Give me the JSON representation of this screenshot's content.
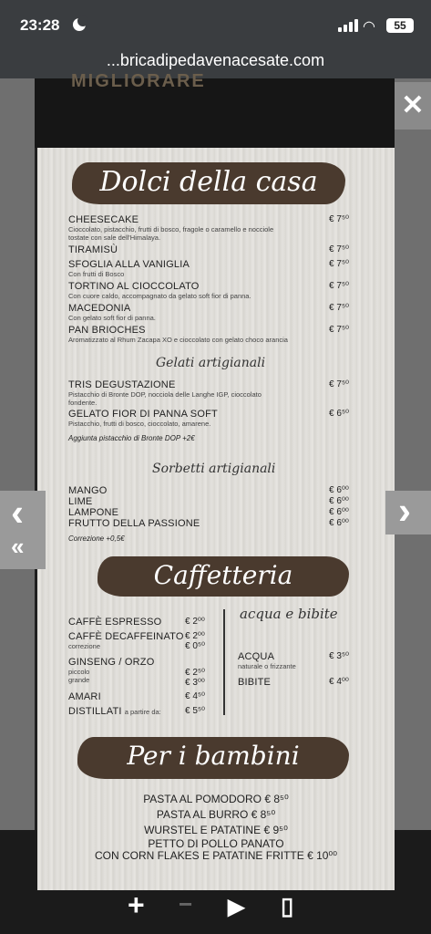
{
  "status": {
    "time": "23:28",
    "battery": "55"
  },
  "browser": {
    "url": "...bricadipedavenacesate.com"
  },
  "poster_header_text": "MIGLIORARE",
  "controls": {
    "close": "✕",
    "prev": "‹",
    "next": "›",
    "first": "«"
  },
  "dolci": {
    "title": "Dolci della casa",
    "items": [
      {
        "name": "CHEESECAKE",
        "desc": "Cioccolato, pistacchio, frutti di bosco, fragole o caramello e nocciole tostate con sale dell'Himalaya.",
        "price": "€ 7⁵⁰"
      },
      {
        "name": "TIRAMISÙ",
        "desc": "",
        "price": "€ 7⁵⁰"
      },
      {
        "name": "SFOGLIA ALLA VANIGLIA",
        "desc": "Con frutti di Bosco",
        "price": "€ 7⁵⁰"
      },
      {
        "name": "TORTINO AL CIOCCOLATO",
        "desc": "Con cuore caldo, accompagnato da gelato soft fior di panna.",
        "price": "€ 7⁵⁰"
      },
      {
        "name": "MACEDONIA",
        "desc": "Con gelato soft fior di panna.",
        "price": "€ 7⁵⁰"
      },
      {
        "name": "PAN BRIOCHES",
        "desc": "Aromatizzato al Rhum Zacapa XO e cioccolato con gelato choco arancia",
        "price": "€ 7⁵⁰"
      }
    ]
  },
  "gelati": {
    "title": "Gelati artigianali",
    "items": [
      {
        "name": "TRIS DEGUSTAZIONE",
        "desc": "Pistacchio di Bronte DOP, nocciola delle Langhe IGP, cioccolato fondente.",
        "price": "€ 7⁵⁰"
      },
      {
        "name": "GELATO FIOR DI PANNA SOFT",
        "desc": "Pistacchio, frutti di bosco, cioccolato, amarene.",
        "price": "€ 6⁵⁰"
      }
    ],
    "note": "Aggiunta pistacchio di Bronte DOP +2€"
  },
  "sorbetti": {
    "title": "Sorbetti artigianali",
    "items": [
      {
        "name": "MANGO",
        "price": "€ 6⁰⁰"
      },
      {
        "name": "LIME",
        "price": "€ 6⁰⁰"
      },
      {
        "name": "LAMPONE",
        "price": "€ 6⁰⁰"
      },
      {
        "name": "FRUTTO DELLA PASSIONE",
        "price": "€ 6⁰⁰"
      }
    ],
    "note": "Correzione +0,5€"
  },
  "caffetteria": {
    "title": "Caffetteria",
    "left": [
      {
        "name": "CAFFÈ ESPRESSO",
        "sub": "",
        "price": "€ 2⁰⁰"
      },
      {
        "name": "CAFFÈ DECAFFEINATO",
        "sub": "correzione",
        "price": "€ 2⁰⁰",
        "price2": "€ 0⁵⁰"
      },
      {
        "name": "GINSENG / ORZO",
        "sub": "piccolo",
        "sub2": "grande",
        "price": "€ 2⁵⁰",
        "price2": "€ 3⁰⁰"
      },
      {
        "name": "AMARI",
        "sub": "",
        "price": "€ 4⁵⁰"
      },
      {
        "name": "DISTILLATI",
        "sub": "a partire da:",
        "price": "€ 5⁵⁰"
      }
    ],
    "right_title": "acqua e bibite",
    "right": [
      {
        "name": "ACQUA",
        "sub": "naturale o frizzante",
        "price": "€ 3⁵⁰"
      },
      {
        "name": "BIBITE",
        "sub": "",
        "price": "€ 4⁰⁰"
      }
    ]
  },
  "bambini": {
    "title": "Per i bambini",
    "items": [
      "PASTA AL POMODORO € 8⁵⁰",
      "PASTA AL BURRO € 8⁵⁰",
      "WURSTEL E PATATINE € 9⁵⁰",
      "PETTO DI POLLO PANATO",
      "CON CORN FLAKES E PATATINE FRITTE € 10⁰⁰"
    ]
  },
  "toolbar": {
    "plus": "+",
    "minus": "−",
    "play": "▶",
    "doc": "▯"
  }
}
